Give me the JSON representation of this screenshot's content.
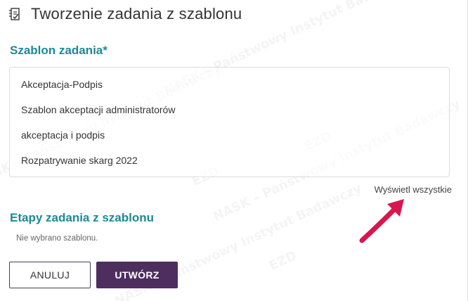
{
  "dialog": {
    "title": "Tworzenie zadania z szablonu",
    "header_icon": "task-template-icon"
  },
  "template_section": {
    "label": "Szablon zadania*",
    "items": [
      "Akceptacja-Podpis",
      "Szablon akceptacji administratorów",
      "akceptacja i podpis",
      "Rozpatrywanie skarg 2022"
    ],
    "show_all_label": "Wyświetl wszystkie"
  },
  "stages_section": {
    "label": "Etapy zadania z szablonu",
    "empty_text": "Nie wybrano szablonu."
  },
  "actions": {
    "cancel_label": "ANULUJ",
    "create_label": "UTWÓRZ"
  },
  "watermark": {
    "text": "NASK – Państwowy Instytut Badawczy",
    "logo_text": "EZD"
  },
  "colors": {
    "accent_teal": "#1b8a96",
    "primary_button": "#4d2e5e",
    "annotation_arrow": "#d8174f"
  }
}
